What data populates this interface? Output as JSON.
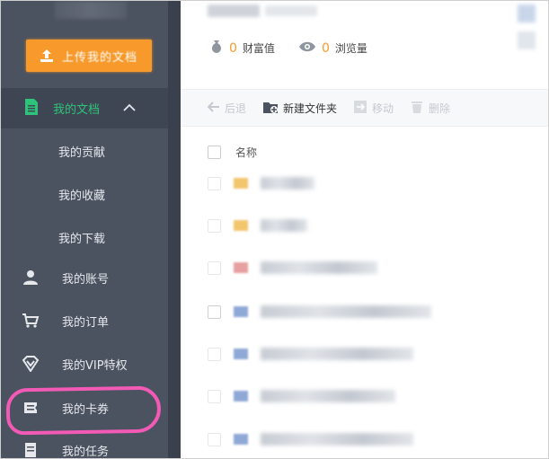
{
  "sidebar": {
    "upload_label": "上传我的文档",
    "my_docs_label": "我的文档",
    "sub_items": [
      {
        "label": "我的贡献"
      },
      {
        "label": "我的收藏"
      },
      {
        "label": "我的下载"
      }
    ],
    "nav_items": [
      {
        "label": "我的账号",
        "icon": "user-icon"
      },
      {
        "label": "我的订单",
        "icon": "cart-icon"
      },
      {
        "label": "我的VIP特权",
        "icon": "diamond-icon"
      },
      {
        "label": "我的卡券",
        "icon": "ticket-icon"
      },
      {
        "label": "我的任务",
        "icon": "document-icon"
      }
    ]
  },
  "stats": {
    "wealth_value": "0",
    "wealth_label": "财富值",
    "views_value": "0",
    "views_label": "浏览量"
  },
  "toolbar": {
    "back": "后退",
    "new_folder": "新建文件夹",
    "move": "移动",
    "delete": "删除"
  },
  "file_list": {
    "name_header": "名称"
  },
  "colors": {
    "accent_orange": "#f79a2b",
    "accent_green": "#2fc27b",
    "sidebar_bg": "#4b5260",
    "highlight_pink": "#f25ab6"
  }
}
